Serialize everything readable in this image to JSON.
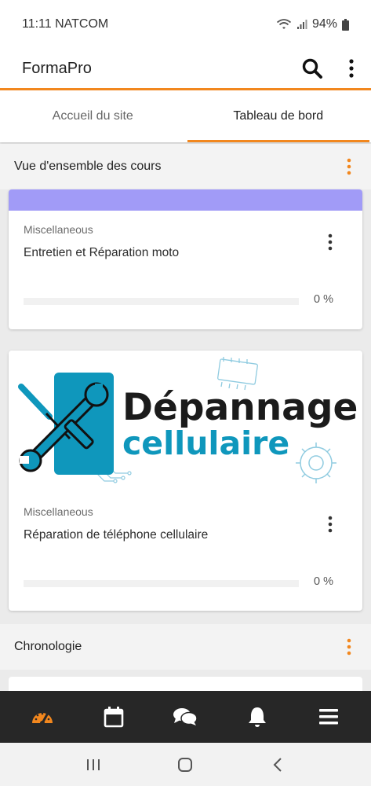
{
  "status_bar": {
    "time_carrier": "11:11 NATCOM",
    "battery": "94%"
  },
  "app": {
    "title": "FormaPro",
    "icons": [
      "search-icon",
      "more-vert-icon"
    ]
  },
  "tabs": [
    {
      "label": "Accueil du site",
      "active": false
    },
    {
      "label": "Tableau de bord",
      "active": true
    }
  ],
  "course_overview": {
    "title": "Vue d'ensemble des cours",
    "courses": [
      {
        "category": "Miscellaneous",
        "name": "Entretien et Réparation moto",
        "progress_text": "0 %",
        "progress": 0,
        "banner_color": "#a19bf7"
      },
      {
        "category": "Miscellaneous",
        "name": "Réparation de téléphone cellulaire",
        "progress_text": "0 %",
        "progress": 0,
        "image_text_line1": "Dépannage",
        "image_text_line2": "cellulaire"
      }
    ]
  },
  "timeline": {
    "title": "Chronologie"
  },
  "bottom_nav": [
    "dashboard-icon",
    "calendar-icon",
    "messages-icon",
    "notifications-icon",
    "menu-icon"
  ],
  "system_nav": [
    "recent-apps-icon",
    "home-icon",
    "back-icon"
  ],
  "colors": {
    "accent": "#f2871e",
    "banner": "#a19bf7",
    "logo_blue": "#0f97bc",
    "nav_bg": "#272727"
  }
}
